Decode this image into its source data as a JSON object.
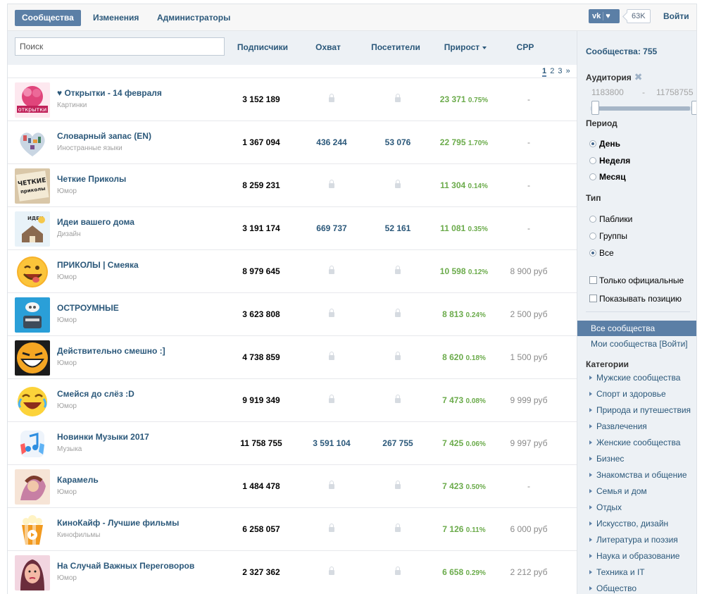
{
  "tabs": {
    "communities": "Сообщества",
    "changes": "Изменения",
    "admins": "Администраторы"
  },
  "vk": {
    "logo": "vk-logo",
    "heart": "♥",
    "count": "63K"
  },
  "login": "Войти",
  "search": {
    "placeholder": "Поиск"
  },
  "columns": {
    "subs": "Подписчики",
    "reach": "Охват",
    "visits": "Посетители",
    "growth": "Прирост",
    "cpp": "CPP"
  },
  "pager": {
    "p1": "1",
    "p2": "2",
    "p3": "3",
    "next": "»"
  },
  "rows": [
    {
      "name": "♥ Открытки - 14 февраля",
      "cat": "Картинки",
      "subs": "3 152 189",
      "reach": null,
      "visits": null,
      "growth": "23 371",
      "pct": "0.75%",
      "cpp": "-"
    },
    {
      "name": "Словарный запас (EN)",
      "cat": "Иностранные языки",
      "subs": "1 367 094",
      "reach": "436 244",
      "visits": "53 076",
      "growth": "22 795",
      "pct": "1.70%",
      "cpp": "-"
    },
    {
      "name": "Четкие Приколы",
      "cat": "Юмор",
      "subs": "8 259 231",
      "reach": null,
      "visits": null,
      "growth": "11 304",
      "pct": "0.14%",
      "cpp": "-"
    },
    {
      "name": "Идеи вашего дома",
      "cat": "Дизайн",
      "subs": "3 191 174",
      "reach": "669 737",
      "visits": "52 161",
      "growth": "11 081",
      "pct": "0.35%",
      "cpp": "-"
    },
    {
      "name": "ПРИКОЛЫ | Смеяка",
      "cat": "Юмор",
      "subs": "8 979 645",
      "reach": null,
      "visits": null,
      "growth": "10 598",
      "pct": "0.12%",
      "cpp": "8 900 руб"
    },
    {
      "name": "ОСТРОУМНЫЕ",
      "cat": "Юмор",
      "subs": "3 623 808",
      "reach": null,
      "visits": null,
      "growth": "8 813",
      "pct": "0.24%",
      "cpp": "2 500 руб"
    },
    {
      "name": "Действительно смешно :]",
      "cat": "Юмор",
      "subs": "4 738 859",
      "reach": null,
      "visits": null,
      "growth": "8 620",
      "pct": "0.18%",
      "cpp": "1 500 руб"
    },
    {
      "name": "Смейся до слёз :D",
      "cat": "Юмор",
      "subs": "9 919 349",
      "reach": null,
      "visits": null,
      "growth": "7 473",
      "pct": "0.08%",
      "cpp": "9 999 руб"
    },
    {
      "name": "Новинки Музыки 2017",
      "cat": "Музыка",
      "subs": "11 758 755",
      "reach": "3 591 104",
      "visits": "267 755",
      "growth": "7 425",
      "pct": "0.06%",
      "cpp": "9 997 руб"
    },
    {
      "name": "Карамель",
      "cat": "Юмор",
      "subs": "1 484 478",
      "reach": null,
      "visits": null,
      "growth": "7 423",
      "pct": "0.50%",
      "cpp": "-"
    },
    {
      "name": "КиноКайф - Лучшие фильмы",
      "cat": "Кинофильмы",
      "subs": "6 258 057",
      "reach": null,
      "visits": null,
      "growth": "7 126",
      "pct": "0.11%",
      "cpp": "6 000 руб"
    },
    {
      "name": "На Случай Важных Переговоров",
      "cat": "Юмор",
      "subs": "2 327 362",
      "reach": null,
      "visits": null,
      "growth": "6 658",
      "pct": "0.29%",
      "cpp": "2 212 руб"
    }
  ],
  "sidebar": {
    "title": "Сообщества: 755",
    "audience": "Аудитория",
    "range_min": "1183800",
    "range_sep": "-",
    "range_max": "11758755",
    "period": "Период",
    "period_day": "День",
    "period_week": "Неделя",
    "period_month": "Месяц",
    "type": "Тип",
    "type_publics": "Паблики",
    "type_groups": "Группы",
    "type_all": "Все",
    "only_official": "Только официальные",
    "show_position": "Показывать позицию",
    "all_communities": "Все сообщества",
    "my_communities": "Мои сообщества [Войти]",
    "categories_title": "Категории",
    "categories": [
      "Мужские сообщества",
      "Спорт и здоровье",
      "Природа и путешествия",
      "Развлечения",
      "Женские сообщества",
      "Бизнес",
      "Знакомства и общение",
      "Семья и дом",
      "Отдых",
      "Искусство, дизайн",
      "Литература и поэзия",
      "Наука и образование",
      "Техника и IT",
      "Общество"
    ]
  },
  "colors": {
    "accent": "#5b7fa6",
    "link": "#2b587a",
    "growth": "#6bab4b"
  }
}
